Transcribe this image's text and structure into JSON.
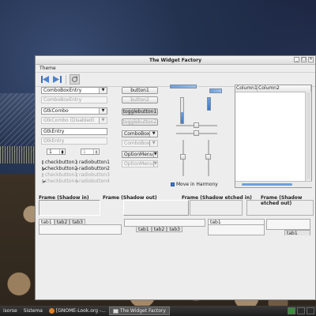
{
  "window": {
    "title": "The Widget Factory",
    "menu": [
      "Theme"
    ]
  },
  "left": {
    "combo_entry": "ComboBoxEntry",
    "combo_entry_disabled": "ComboBoxEntry",
    "gtk_combo": "GtkCombo",
    "gtk_combo_disabled": "GtkCombo (Disabled)",
    "entry": "GtkEntry",
    "entry_disabled": "GtkEntry",
    "spin1": "1",
    "spin2": "1",
    "checks": [
      {
        "label": "checkbutton1",
        "checked": false,
        "disabled": false
      },
      {
        "label": "checkbutton2",
        "checked": true,
        "disabled": false
      },
      {
        "label": "checkbutton3",
        "checked": false,
        "disabled": true
      },
      {
        "label": "checkbutton4",
        "checked": true,
        "disabled": true
      }
    ],
    "radios": [
      {
        "label": "radiobutton1",
        "checked": false,
        "disabled": false
      },
      {
        "label": "radiobutton2",
        "checked": true,
        "disabled": false
      },
      {
        "label": "radiobutton3",
        "checked": false,
        "disabled": true
      },
      {
        "label": "radiobutton4",
        "checked": true,
        "disabled": true
      }
    ]
  },
  "middle": {
    "button1": "button1",
    "button2": "button2",
    "toggle1": "togglebutton1",
    "toggle2": "togglebutton2",
    "combobox": "ComboBox",
    "combobox_disabled": "ComboBox",
    "optionmenu": "OptionMenu",
    "optionmenu_disabled": "OptionMenu"
  },
  "sliders": {
    "move_in_harmony": "Move in Harmony",
    "move_in_harmony_checked": true
  },
  "treeview": {
    "columns": [
      "Column1",
      "Column2"
    ]
  },
  "frames": [
    "Frame (Shadow in)",
    "Frame (Shadow out)",
    "Frame (Shadow etched in)",
    "Frame (Shadow etched out)"
  ],
  "notebooks": {
    "nb1": [
      "tab1",
      "tab2",
      "tab3"
    ],
    "nb2": [
      "tab1",
      "tab2",
      "tab3"
    ],
    "nb3": [
      "tab1"
    ],
    "nb4": [
      "tab1"
    ]
  },
  "taskbar": {
    "items": [
      "Sistema",
      "[GNOME-Look.org -...",
      "The Widget Factory"
    ],
    "left_fragment": "isorse"
  }
}
